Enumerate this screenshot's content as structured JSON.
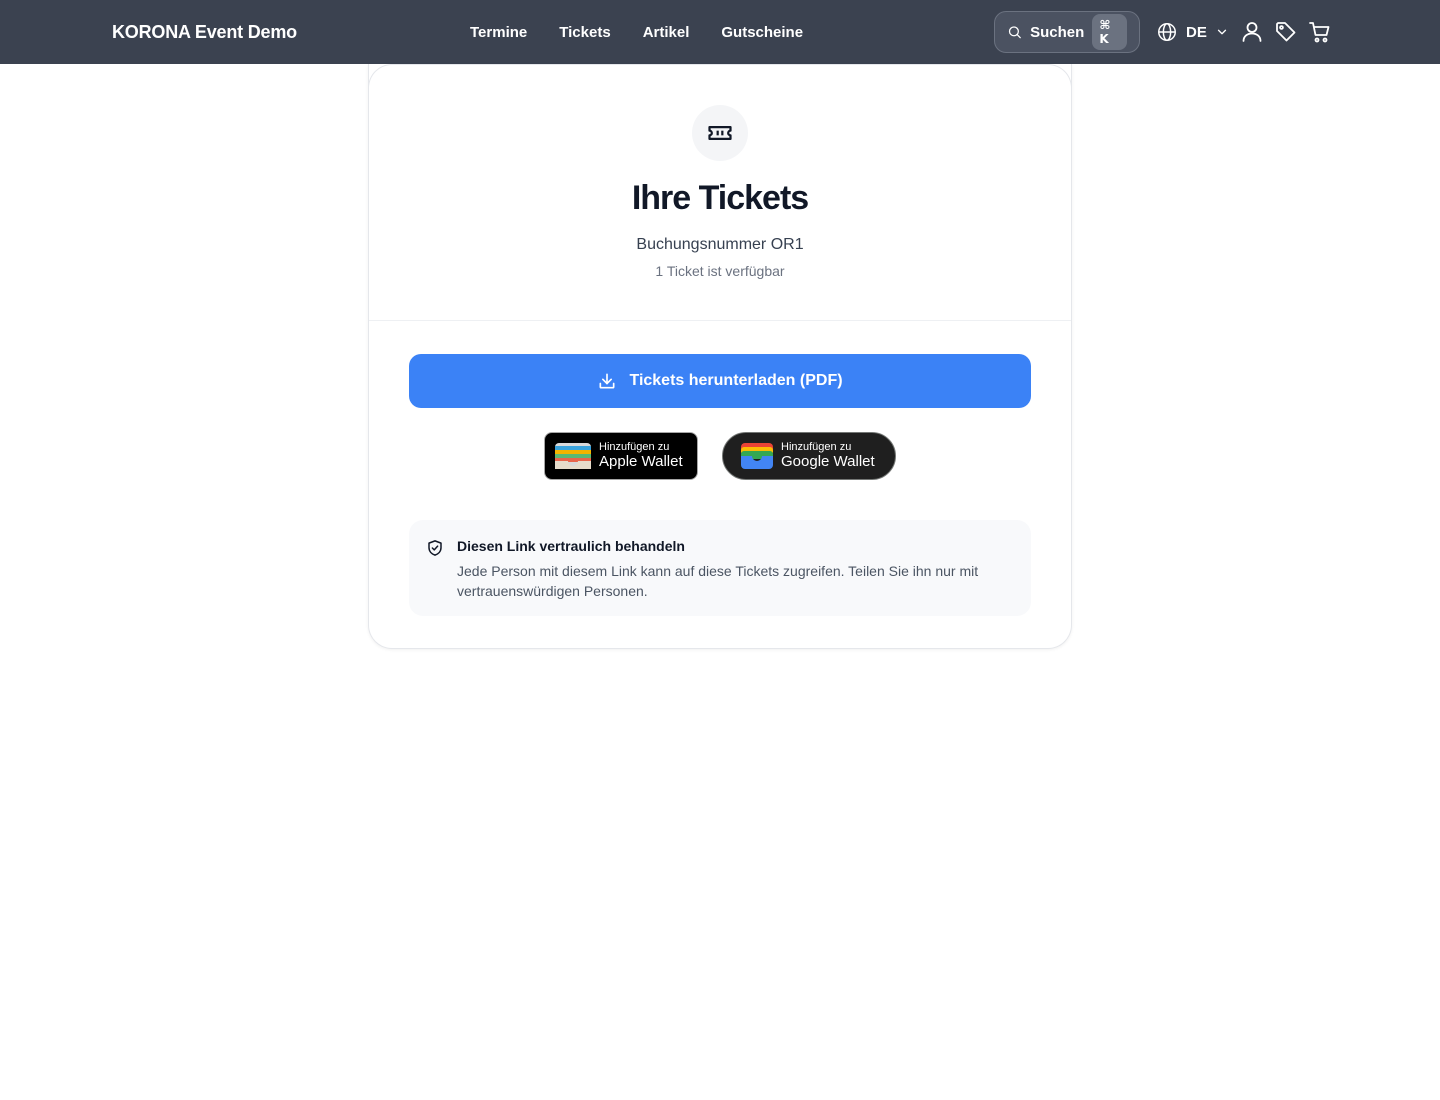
{
  "header": {
    "brand": "KORONA Event Demo",
    "nav": [
      "Termine",
      "Tickets",
      "Artikel",
      "Gutscheine"
    ],
    "search_label": "Suchen",
    "search_shortcut": "⌘ K",
    "language": "DE",
    "icons": [
      "user-icon",
      "tag-icon",
      "cart-icon"
    ]
  },
  "card": {
    "title": "Ihre Tickets",
    "booking_number": "Buchungsnummer OR1",
    "availability": "1 Ticket ist verfügbar",
    "download_label": "Tickets herunterladen (PDF)",
    "apple_wallet": {
      "small": "Hinzufügen zu",
      "big": "Apple Wallet"
    },
    "google_wallet": {
      "small": "Hinzufügen zu",
      "big": "Google Wallet"
    },
    "notice": {
      "title": "Diesen Link vertraulich behandeln",
      "body": "Jede Person mit diesem Link kann auf diese Tickets zugreifen. Teilen Sie ihn nur mit vertrauenswürdigen Personen."
    }
  },
  "colors": {
    "header_bg": "#3b4250",
    "primary": "#3b82f6"
  }
}
